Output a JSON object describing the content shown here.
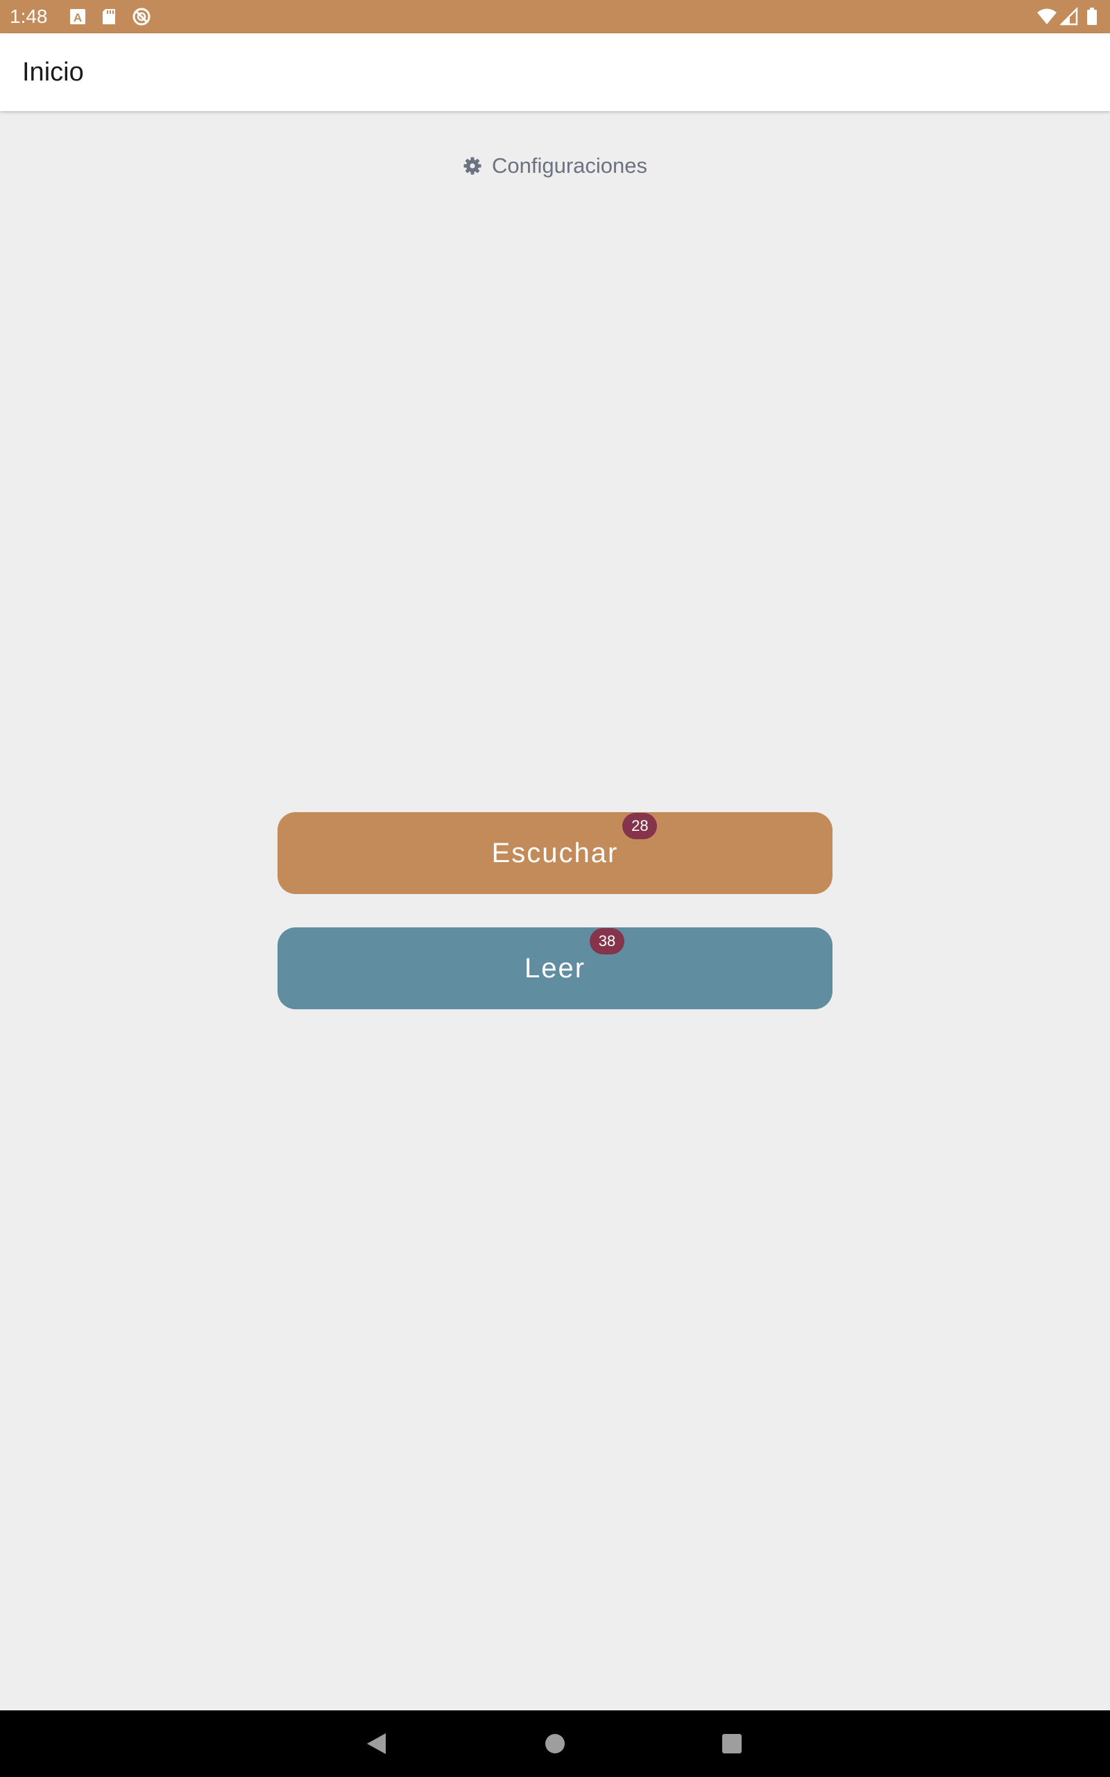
{
  "status_bar": {
    "time": "1:48",
    "color": "#c38b59",
    "left_icons": [
      "a-keyboard-icon",
      "sd-card-icon",
      "no-sync-icon"
    ],
    "right_icons": [
      "wifi-icon",
      "signal-icon",
      "battery-icon"
    ]
  },
  "app_bar": {
    "title": "Inicio"
  },
  "settings": {
    "label": "Configuraciones",
    "icon": "gear-icon"
  },
  "buttons": {
    "listen": {
      "label": "Escuchar",
      "badge": "28",
      "color": "#c38b59"
    },
    "read": {
      "label": "Leer",
      "badge": "38",
      "color": "#618da1"
    },
    "badge_color": "#86344b"
  },
  "nav_bar": {
    "buttons": [
      "back-icon",
      "home-icon",
      "recents-icon"
    ]
  }
}
